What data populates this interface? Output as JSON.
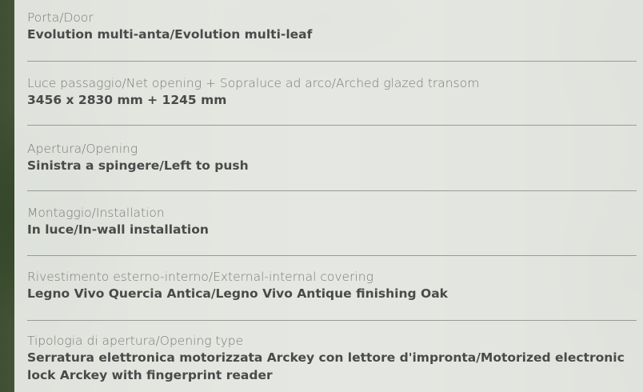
{
  "specs": [
    {
      "label": "Porta/Door",
      "value": "Evolution multi-anta/Evolution multi-leaf"
    },
    {
      "label": "Luce passaggio/Net opening + Sopraluce ad arco/Arched glazed transom",
      "value": "3456 x 2830 mm + 1245 mm"
    },
    {
      "label": "Apertura/Opening",
      "value": "Sinistra a spingere/Left to push"
    },
    {
      "label": "Montaggio/Installation",
      "value": "In luce/In-wall installation"
    },
    {
      "label": "Rivestimento esterno-interno/External-internal covering",
      "value": "Legno Vivo Quercia Antica/Legno Vivo Antique finishing Oak"
    },
    {
      "label": "Tipologia di apertura/Opening type",
      "value": "Serratura elettronica motorizzata Arckey con lettore d'impronta/Motorized electronic lock Arckey with fingerprint reader"
    }
  ]
}
